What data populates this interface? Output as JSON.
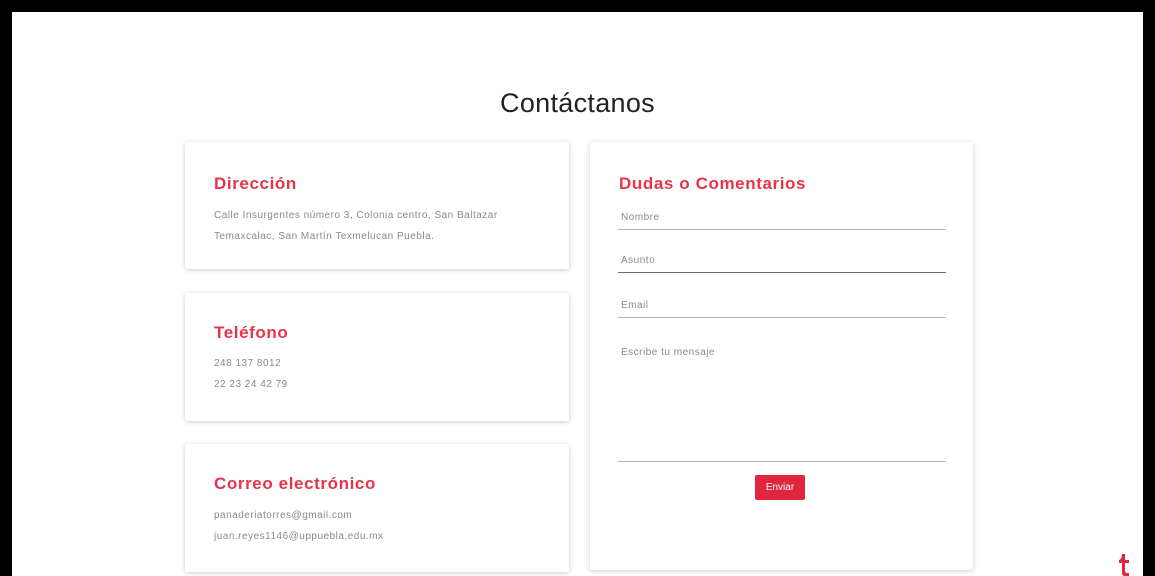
{
  "page": {
    "title": "Contáctanos"
  },
  "direccion": {
    "heading": "Dirección",
    "text": "Calle Insurgentes número 3, Colonia centro, San Baltazar Temaxcalac, San Martín Texmelucan Puebla."
  },
  "telefono": {
    "heading": "Teléfono",
    "numbers": [
      "248 137 8012",
      "22 23 24 42 79"
    ]
  },
  "correo": {
    "heading": "Correo electrónico",
    "emails": [
      "panaderiatorres@gmail.com",
      "juan.reyes1146@uppuebla.edu.mx"
    ]
  },
  "form": {
    "heading": "Dudas o Comentarios",
    "nombre_placeholder": "Nombre",
    "asunto_placeholder": "Asunto",
    "email_placeholder": "Email",
    "mensaje_placeholder": "Escribe tu mensaje",
    "submit_label": "Enviar"
  },
  "colors": {
    "accent": "#e8334a",
    "button": "#e0263f",
    "frame": "#000000"
  },
  "icons": {
    "corner": "brand-logo-icon"
  }
}
